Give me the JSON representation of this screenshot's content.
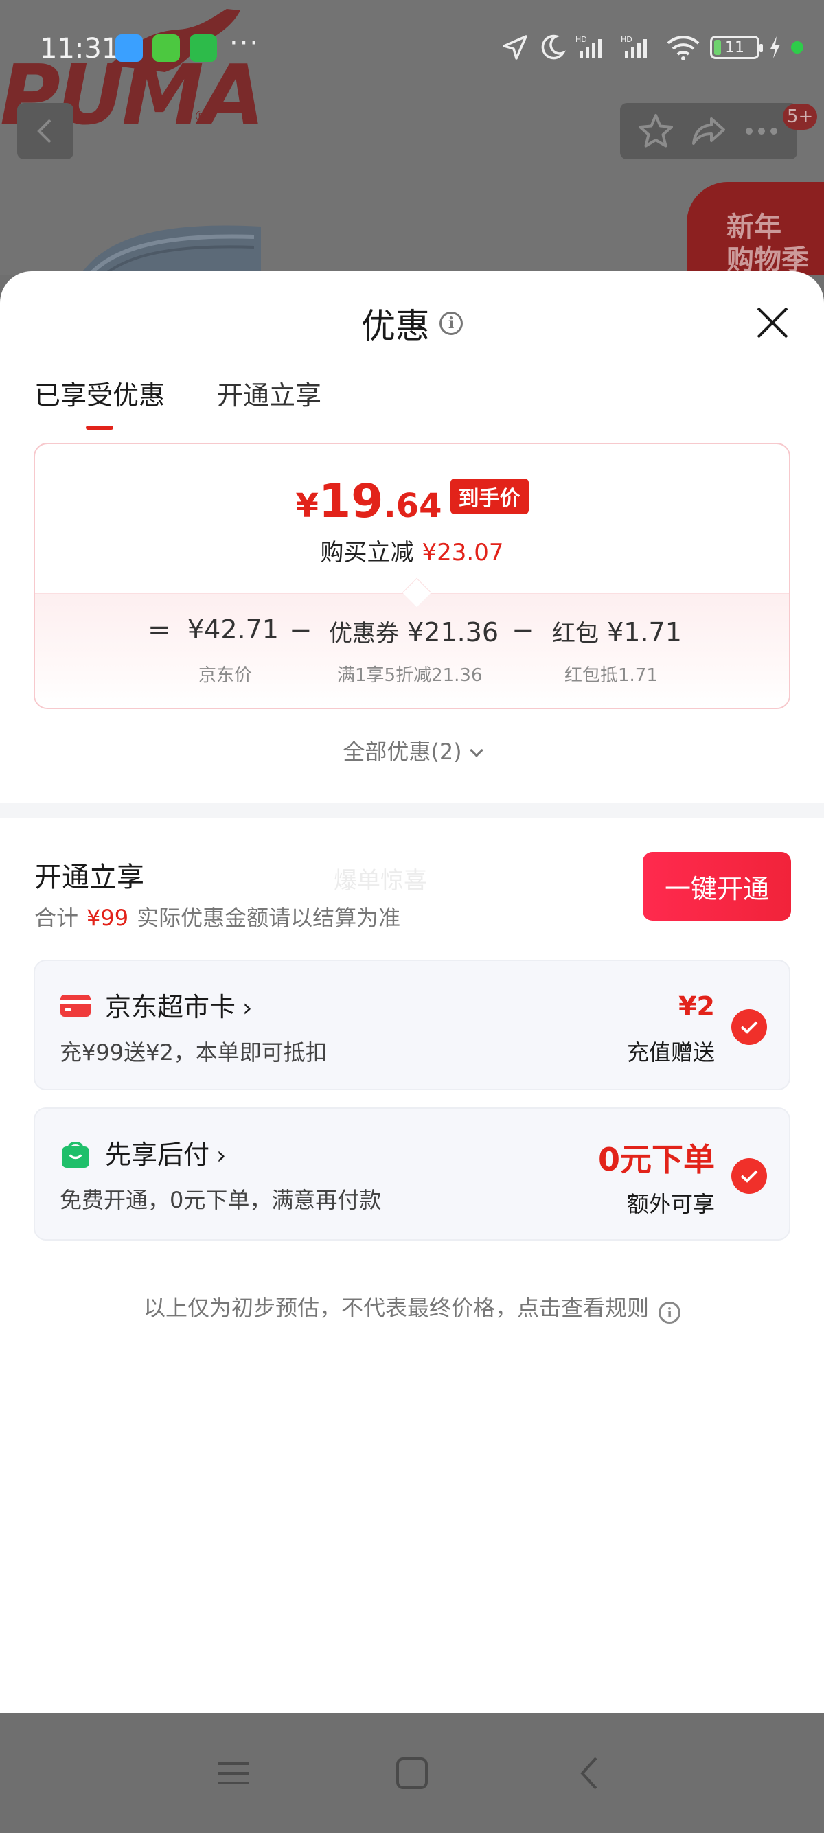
{
  "status_bar": {
    "time": "11:31",
    "more": "···",
    "battery": "11",
    "icons": [
      "location-icon",
      "moon-icon",
      "signal-hd-icon",
      "signal-hd-icon",
      "wifi-icon",
      "battery-icon",
      "charging-icon"
    ]
  },
  "background": {
    "brand": "PUMA",
    "brand_mark": "®",
    "badge": "5+",
    "promo": [
      "新年",
      "购物季"
    ]
  },
  "sheet": {
    "title": "优惠",
    "tabs": [
      {
        "label": "已享受优惠",
        "active": true
      },
      {
        "label": "开通立享",
        "active": false
      }
    ],
    "price": {
      "yen": "¥",
      "int": "19",
      "dec": ".64",
      "tag": "到手价",
      "reduce_label": "购买立减",
      "reduce_amount": "¥23.07"
    },
    "calc": {
      "eq": "=",
      "minus": "−",
      "items": [
        {
          "label": "",
          "value": "¥42.71",
          "sub": "京东价"
        },
        {
          "label": "优惠券",
          "value": "¥21.36",
          "sub": "满1享5折减21.36"
        },
        {
          "label": "红包",
          "value": "¥1.71",
          "sub": "红包抵1.71"
        }
      ]
    },
    "all_offers": "全部优惠(2)",
    "open_section": {
      "title": "开通立享",
      "watermark": "爆单惊喜",
      "sub_prefix": "合计",
      "sub_amount": "¥99",
      "sub_suffix": "实际优惠金额请以结算为准",
      "button": "一键开通"
    },
    "services": [
      {
        "name": "京东超市卡",
        "arrow": "›",
        "desc": "充¥99送¥2，本单即可抵扣",
        "value": "¥2",
        "value_sub": "充值赠送",
        "checked": true
      },
      {
        "name": "先享后付",
        "arrow": "›",
        "desc": "免费开通，0元下单，满意再付款",
        "value": "0元下单",
        "value_sub": "额外可享",
        "checked": true
      }
    ],
    "footnote": "以上仅为初步预估，不代表最终价格，点击查看规则"
  },
  "colors": {
    "accent": "#e2231a",
    "button": "#f1233a",
    "card_bg": "#f6f7fb"
  }
}
